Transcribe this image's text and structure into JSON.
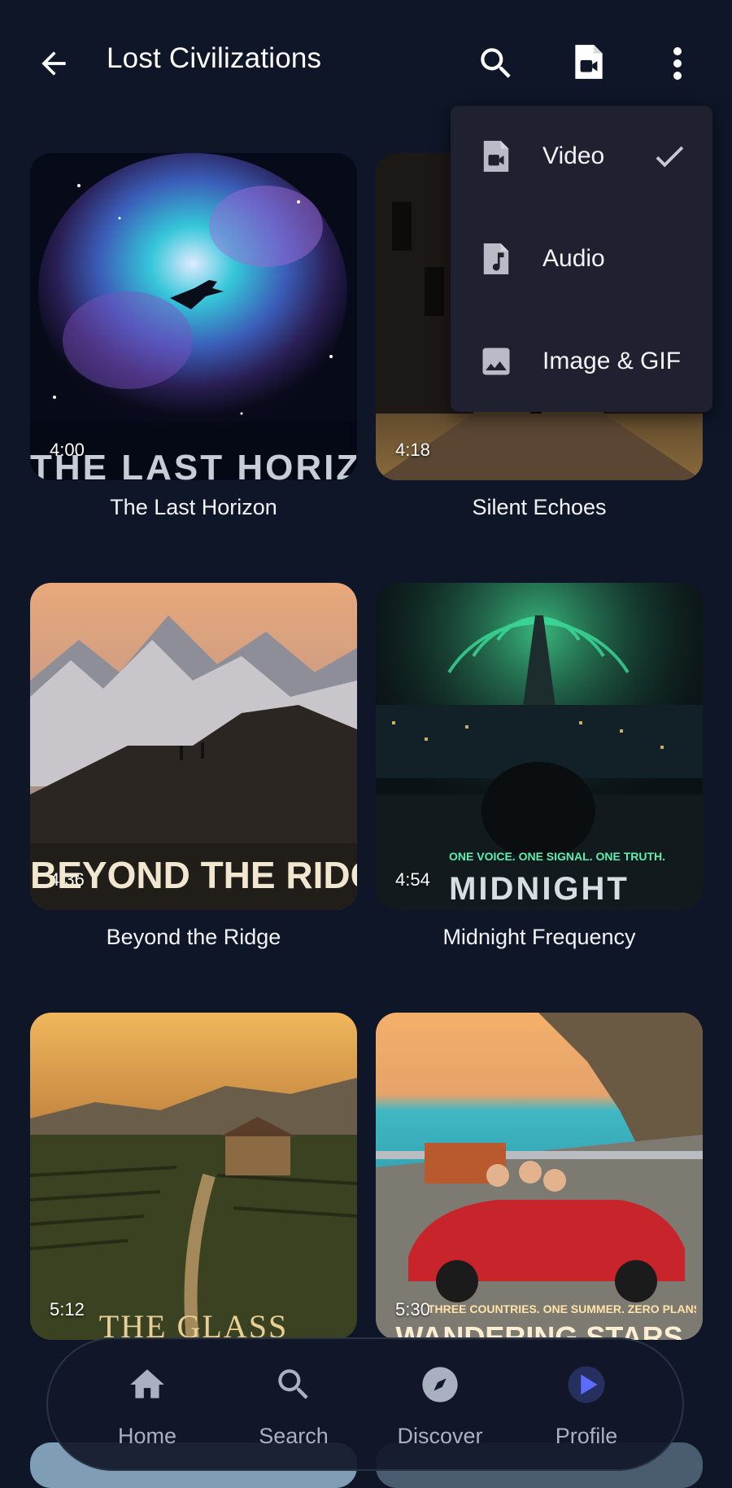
{
  "header": {
    "title": "Lost Civilizations",
    "back_icon": "arrow-left-icon",
    "search_icon": "search-icon",
    "video_icon": "video-file-icon",
    "more_icon": "more-vert-icon"
  },
  "media_menu": {
    "items": [
      {
        "label": "Video",
        "icon": "video-file-icon",
        "selected": true
      },
      {
        "label": "Audio",
        "icon": "audio-file-icon",
        "selected": false
      },
      {
        "label": "Image & GIF",
        "icon": "image-icon",
        "selected": false
      }
    ]
  },
  "videos": [
    {
      "title": "The Last Horizon",
      "duration": "4:00",
      "poster_text": "THE LAST HORIZON"
    },
    {
      "title": "Silent Echoes",
      "duration": "4:18",
      "poster_text": ""
    },
    {
      "title": "Beyond the Ridge",
      "duration": "4:36",
      "poster_text": "BEYOND THE RIDGE"
    },
    {
      "title": "Midnight Frequency",
      "duration": "4:54",
      "poster_text": "MIDNIGHT",
      "poster_tagline": "ONE VOICE. ONE SIGNAL. ONE TRUTH."
    },
    {
      "title": "",
      "duration": "5:12",
      "poster_text": "THE GLASS"
    },
    {
      "title": "",
      "duration": "5:30",
      "poster_text": "WANDERING STARS",
      "poster_tagline": "THREE COUNTRIES. ONE SUMMER. ZERO PLANS."
    }
  ],
  "bottom_nav": {
    "items": [
      {
        "label": "Home",
        "icon": "home-icon",
        "active": false
      },
      {
        "label": "Search",
        "icon": "search-icon",
        "active": false
      },
      {
        "label": "Discover",
        "icon": "compass-icon",
        "active": false
      },
      {
        "label": "Profile",
        "icon": "play-circle-icon",
        "active": true
      }
    ]
  },
  "colors": {
    "background": "#0e1628",
    "menu_background": "#1f2130",
    "accent": "#5b6cff",
    "nav_label": "#a9b0bf"
  }
}
